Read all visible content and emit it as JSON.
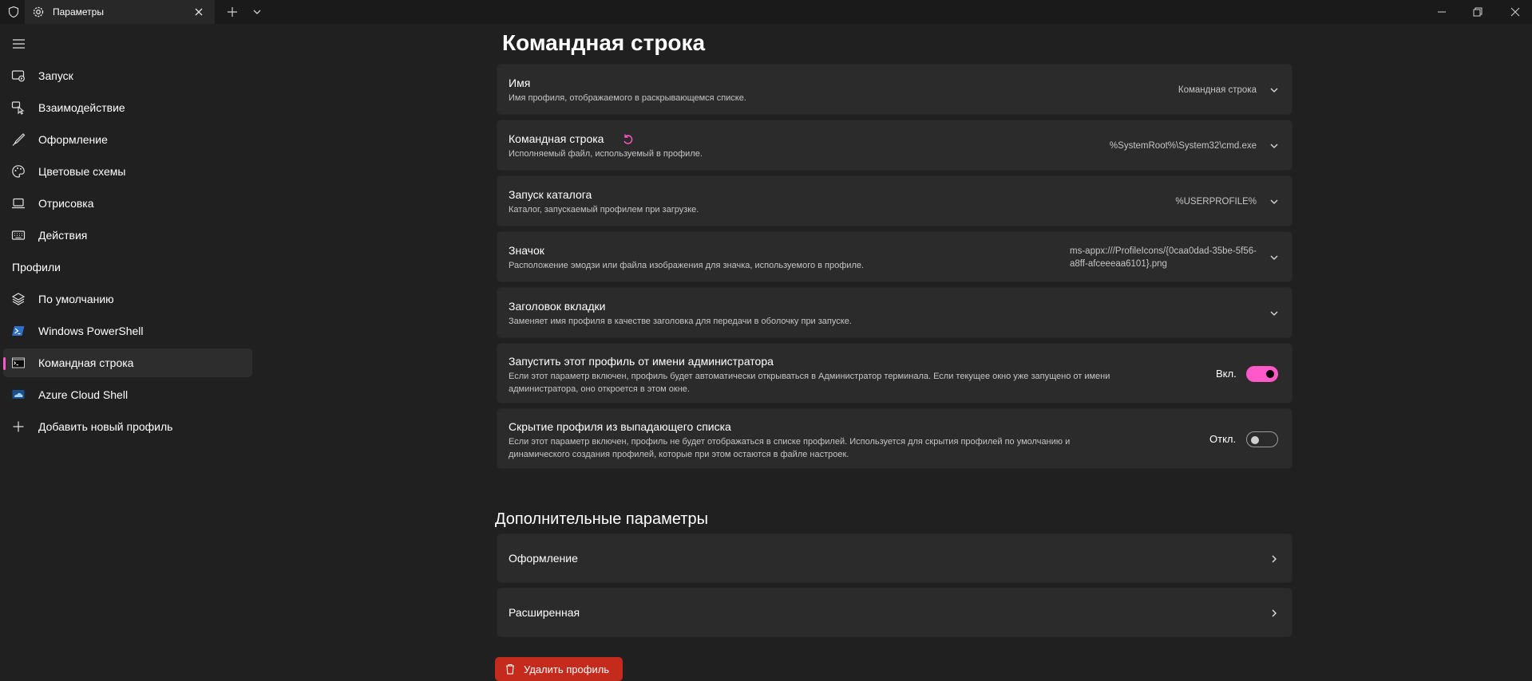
{
  "window": {
    "tab_title": "Параметры"
  },
  "sidebar": {
    "items": [
      {
        "label": "Запуск",
        "icon": "launch-icon"
      },
      {
        "label": "Взаимодействие",
        "icon": "interaction-icon"
      },
      {
        "label": "Оформление",
        "icon": "brush-icon"
      },
      {
        "label": "Цветовые схемы",
        "icon": "palette-icon"
      },
      {
        "label": "Отрисовка",
        "icon": "laptop-icon"
      },
      {
        "label": "Действия",
        "icon": "keyboard-icon"
      }
    ],
    "profiles_header": "Профили",
    "profiles": [
      {
        "label": "По умолчанию",
        "icon": "layers-icon"
      },
      {
        "label": "Windows PowerShell",
        "icon": "powershell-icon"
      },
      {
        "label": "Командная строка",
        "icon": "cmd-icon",
        "selected": true
      },
      {
        "label": "Azure Cloud Shell",
        "icon": "azure-icon"
      },
      {
        "label": "Добавить новый профиль",
        "icon": "plus-icon"
      }
    ]
  },
  "main": {
    "title": "Командная строка",
    "settings": [
      {
        "title": "Имя",
        "description": "Имя профиля, отображаемого в раскрывающемся списке.",
        "value": "Командная строка"
      },
      {
        "title": "Командная строка",
        "description": "Исполняемый файл, используемый в профиле.",
        "value": "%SystemRoot%\\System32\\cmd.exe"
      },
      {
        "title": "Запуск каталога",
        "description": "Каталог, запускаемый профилем при загрузке.",
        "value": "%USERPROFILE%"
      },
      {
        "title": "Значок",
        "description": "Расположение эмодзи или файла изображения для значка, используемого в профиле.",
        "value_line1": "ms-appx:///ProfileIcons/{0caa0dad-35be-5f56-",
        "value_line2": "a8ff-afceeeaa6101}.png"
      },
      {
        "title": "Заголовок вкладки",
        "description": "Заменяет имя профиля в качестве заголовка для передачи в оболочку при запуске.",
        "value": ""
      },
      {
        "title": "Запустить этот профиль от имени администратора",
        "description_line1": "Если этот параметр включен, профиль будет автоматически открываться в Администратор терминала. Если текущее окно уже запущено от имени",
        "description_line2": "администратора, оно откроется в этом окне.",
        "state": "Вкл.",
        "on": true
      },
      {
        "title": "Скрытие профиля из выпадающего списка",
        "description_line1": "Если этот параметр включен, профиль не будет отображаться в списке профилей. Используется для скрытия профилей по умолчанию и",
        "description_line2": "динамического создания профилей, которые при этом остаются в файле настроек.",
        "state": "Откл.",
        "on": false
      }
    ],
    "additional_title": "Дополнительные параметры",
    "additional": [
      {
        "label": "Оформление"
      },
      {
        "label": "Расширенная"
      }
    ],
    "delete_label": "Удалить профиль"
  },
  "colors": {
    "accent": "#ff58c8",
    "background": "#202020",
    "card": "#2b2b2b",
    "danger": "#c42b1c"
  }
}
